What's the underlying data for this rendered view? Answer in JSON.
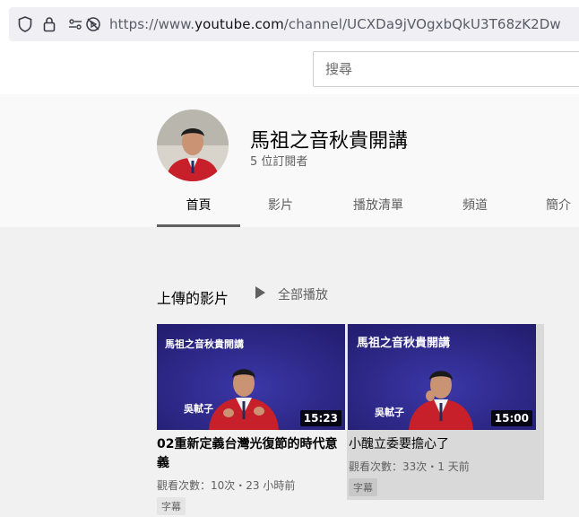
{
  "browser": {
    "url_prefix": "https://www.",
    "url_host": "youtube.com",
    "url_path": "/channel/UCXDa9jVOgxbQkU3T68zK2Dw"
  },
  "header": {
    "search_placeholder": "搜尋"
  },
  "channel": {
    "name": "馬祖之音秋貴開講",
    "subscribers": "5 位訂閱者"
  },
  "tabs": [
    {
      "label": "首頁",
      "active": true
    },
    {
      "label": "影片"
    },
    {
      "label": "播放清單"
    },
    {
      "label": "頻道"
    },
    {
      "label": "簡介"
    }
  ],
  "section": {
    "title": "上傳的影片",
    "play_all": "全部播放"
  },
  "videos": [
    {
      "thumb_title": "馬祖之音秋貴開講",
      "thumb_author": "吳軾子",
      "duration": "15:23",
      "title": "02重新定義台灣光復節的時代意義",
      "meta": "觀看次數：10次・23 小時前",
      "badge": "字幕"
    },
    {
      "thumb_title": "馬祖之音秋貴開講",
      "thumb_author": "吳軾子",
      "duration": "15:00",
      "title": "小醜立委要擔心了",
      "meta": "觀看次數：33次・1 天前",
      "badge": "字幕"
    }
  ],
  "colors": {
    "thumb_bg": "#2e2a8c",
    "shirt_red": "#c8202a"
  }
}
